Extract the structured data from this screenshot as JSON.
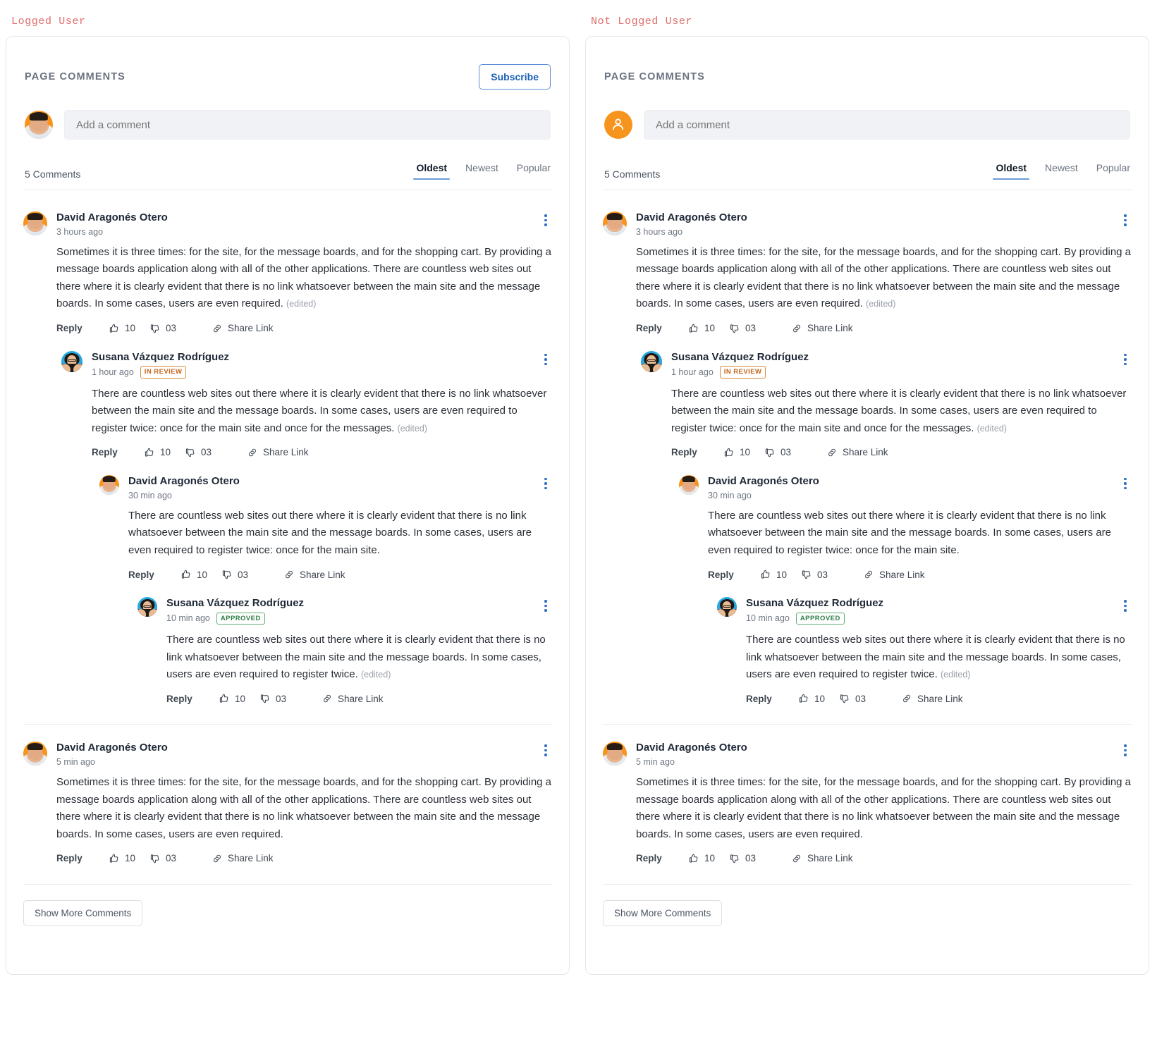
{
  "panels": [
    {
      "label": "Logged User",
      "title": "PAGE COMMENTS",
      "subscribe_label": "Subscribe",
      "has_subscribe": true,
      "logged_in": true,
      "avatar_kind": "photo-david",
      "composer_placeholder": "Add a comment",
      "count_label": "5 Comments",
      "sorts": [
        {
          "label": "Oldest",
          "active": true
        },
        {
          "label": "Newest",
          "active": false
        },
        {
          "label": "Popular",
          "active": false
        }
      ],
      "show_more_label": "Show More Comments"
    },
    {
      "label": "Not Logged User",
      "title": "PAGE COMMENTS",
      "subscribe_label": "",
      "has_subscribe": false,
      "logged_in": false,
      "avatar_kind": "guest",
      "composer_placeholder": "Add a comment",
      "count_label": "5 Comments",
      "sorts": [
        {
          "label": "Oldest",
          "active": true
        },
        {
          "label": "Newest",
          "active": false
        },
        {
          "label": "Popular",
          "active": false
        }
      ],
      "show_more_label": "Show More Comments"
    }
  ],
  "actions": {
    "reply": "Reply",
    "share": "Share Link",
    "likes": "10",
    "dislikes": "03"
  },
  "edited_label": "(edited)",
  "comments": [
    {
      "level": 0,
      "author": "David Aragonés Otero",
      "time": "3 hours ago",
      "avatar": "photo-david",
      "badge": null,
      "text": "Sometimes it is three times: for the site, for the message boards, and for the shopping cart. By providing a message boards application along with all of the other applications. There are countless web sites out there where it is clearly evident that there is no link whatsoever between the main site and the message boards. In some cases, users are even required.",
      "edited": true
    },
    {
      "level": 1,
      "author": "Susana Vázquez Rodríguez",
      "time": "1 hour ago",
      "avatar": "photo-susana",
      "badge": {
        "text": "IN REVIEW",
        "kind": "review"
      },
      "text": "There are countless web sites out there where it is clearly evident that there is no link whatsoever between the main site and the message boards. In some cases, users are even required to register twice: once for the main site and once for the messages.",
      "edited": true
    },
    {
      "level": 2,
      "author": "David Aragonés Otero",
      "time": "30 min ago",
      "avatar": "photo-david",
      "badge": null,
      "text": "There are countless web sites out there where it is clearly evident that there is no link whatsoever between the main site and the message boards. In some cases, users are even required to register twice: once for the main site.",
      "edited": false
    },
    {
      "level": 3,
      "author": "Susana Vázquez Rodríguez",
      "time": "10 min ago",
      "avatar": "photo-susana",
      "badge": {
        "text": "APPROVED",
        "kind": "approved"
      },
      "text": "There are countless web sites out there where it is clearly evident that there is no link whatsoever between the main site and the message boards. In some cases, users are even required to register twice.",
      "edited": true,
      "separator_after": true
    },
    {
      "level": 0,
      "author": "David Aragonés Otero",
      "time": "5 min ago",
      "avatar": "photo-david",
      "badge": null,
      "text": "Sometimes it is three times: for the site, for the message boards, and for the shopping cart. By providing a message boards application along with all of the other applications. There are countless web sites out there where it is clearly evident that there is no link whatsoever between the main site and the message boards. In some cases, users are even required.",
      "edited": false
    }
  ],
  "colors": {
    "label": "#e06c6c",
    "accent_blue": "#2f6fc0",
    "avatar_orange": "#f7941e",
    "avatar_blue": "#29a8e0",
    "badge_review": "#c2661a",
    "badge_approved": "#2f7d46"
  }
}
